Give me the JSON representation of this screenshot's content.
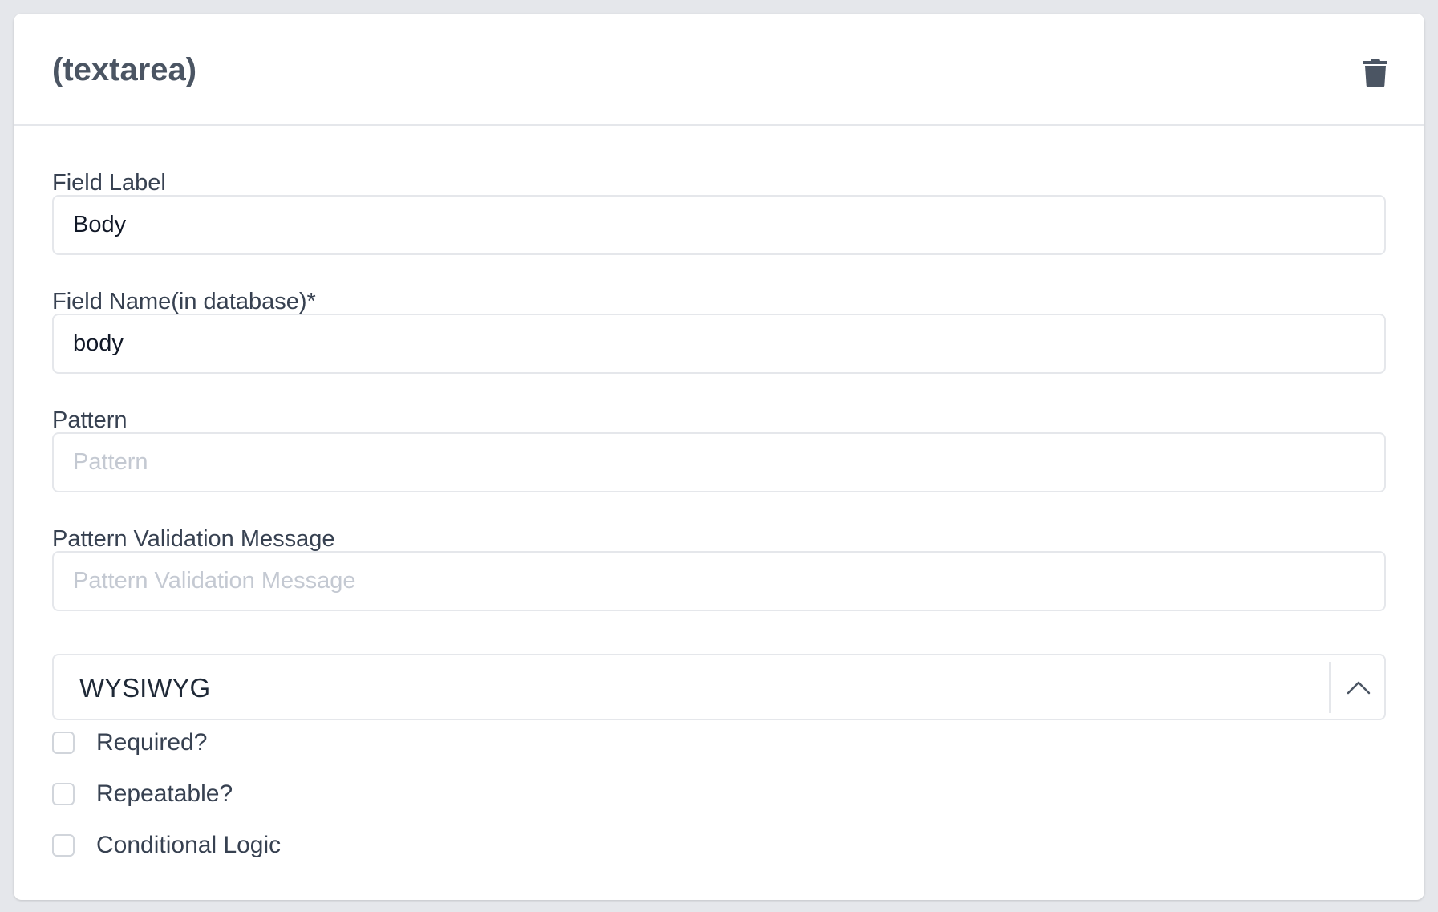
{
  "card": {
    "title": "(textarea)",
    "delete_icon": "trash-icon"
  },
  "fields": {
    "field_label": {
      "label": "Field Label",
      "value": "Body",
      "placeholder": ""
    },
    "field_name": {
      "label": "Field Name(in database)*",
      "value": "body",
      "placeholder": ""
    },
    "pattern": {
      "label": "Pattern",
      "value": "",
      "placeholder": "Pattern"
    },
    "pattern_message": {
      "label": "Pattern Validation Message",
      "value": "",
      "placeholder": "Pattern Validation Message"
    }
  },
  "editor_select": {
    "selected": "WYSIWYG",
    "chevron_icon": "chevron-up-icon"
  },
  "options": {
    "required": {
      "label": "Required?",
      "checked": false
    },
    "repeatable": {
      "label": "Repeatable?",
      "checked": false
    },
    "conditional": {
      "label": "Conditional Logic",
      "checked": false
    }
  },
  "colors": {
    "background": "#e5e7eb",
    "card": "#ffffff",
    "text": "#374151",
    "border": "#e5e7eb",
    "icon": "#4b5563"
  }
}
